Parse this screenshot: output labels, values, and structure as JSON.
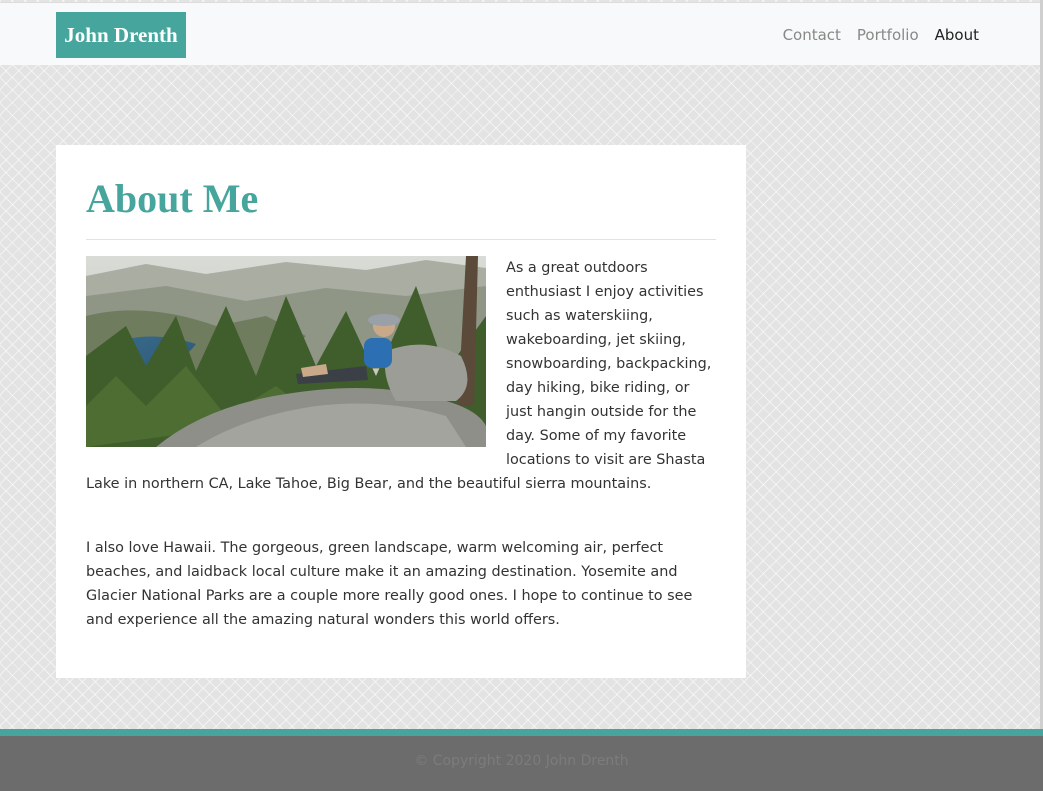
{
  "brand": {
    "name": "John Drenth"
  },
  "nav": {
    "items": [
      "Contact",
      "Portfolio",
      "About"
    ],
    "active": "About"
  },
  "about": {
    "title": "About Me",
    "photo": "hiker-sitting-on-rock-overlooking-mountain-lake",
    "paragraph1": "As a great outdoors enthusiast I enjoy activities such as waterskiing, wakeboarding, jet skiing, snowboarding, backpacking, day hiking, bike riding, or just hangin outside for the day. Some of my favorite locations to visit are Shasta Lake in northern CA, Lake Tahoe, Big Bear, and the beautiful sierra mountains.",
    "paragraph2": "I also love Hawaii. The gorgeous, green landscape, warm welcoming air, perfect beaches, and laidback local culture make it an amazing destination. Yosemite and Glacier National Parks are a couple more really good ones. I hope to continue to see and experience all the amazing natural wonders this world offers."
  },
  "footer": {
    "copyright": "© Copyright 2020 John Drenth"
  },
  "colors": {
    "accent": "#46a59c",
    "footer_bg": "#6c6c6c",
    "nav_bg": "#f8f9fa"
  }
}
